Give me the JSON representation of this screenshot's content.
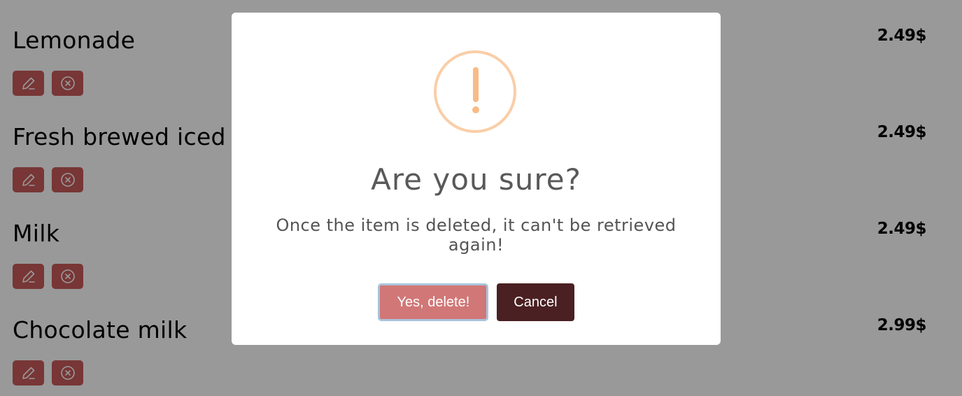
{
  "menu": {
    "items": [
      {
        "name": "Lemonade",
        "price": "2.49$"
      },
      {
        "name": "Fresh brewed iced tea",
        "price": "2.49$"
      },
      {
        "name": "Milk",
        "price": "2.49$"
      },
      {
        "name": "Chocolate milk",
        "price": "2.99$"
      }
    ],
    "edit_icon": "pencil-icon",
    "delete_icon": "circle-x-icon",
    "action_color": "#c95a5a"
  },
  "overlay": {
    "color": "rgba(0,0,0,0.4)"
  },
  "dialog": {
    "icon": "warning-exclamation-icon",
    "icon_color": "#f8bb86",
    "title": "Are you sure?",
    "text": "Once the item is deleted, it can't be retrieved again!",
    "confirm_label": "Yes, delete!",
    "cancel_label": "Cancel",
    "confirm_color": "#d17777",
    "cancel_color": "#4a2022"
  }
}
